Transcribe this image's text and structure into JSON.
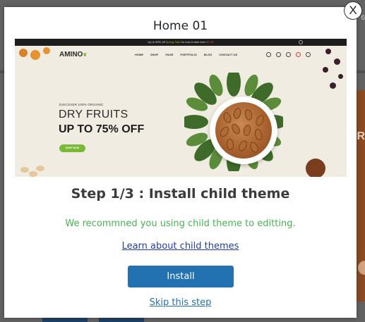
{
  "modal": {
    "title": "Home 01",
    "close_label": "X",
    "step_title": "Step 1/3 : Install child theme",
    "description": "We recommned you using child theme to editting.",
    "learn_link": "Learn about child themes",
    "install_label": "Install",
    "skip_label": "Skip this step"
  },
  "preview": {
    "topbar_pre": "Up to 50% off ",
    "topbar_highlight": "Spring Sale",
    "topbar_post": " for now & later from ",
    "topbar_price": "$7.59",
    "logo": "AMINO",
    "nav": [
      "HOME",
      "SHOP",
      "PAGE",
      "PORTFOLIO",
      "BLOG",
      "CONTACT US"
    ],
    "eyebrow": "DISCOVER 100% ORGANIC",
    "headline": "DRY FRUITS",
    "subheadline": "UP TO 75% OFF",
    "button": "SHOP NOW"
  },
  "background": {
    "corner_text": "6",
    "side_text": "R"
  },
  "colors": {
    "accent": "#2271b1",
    "success": "#46b450",
    "link": "#23409a"
  }
}
